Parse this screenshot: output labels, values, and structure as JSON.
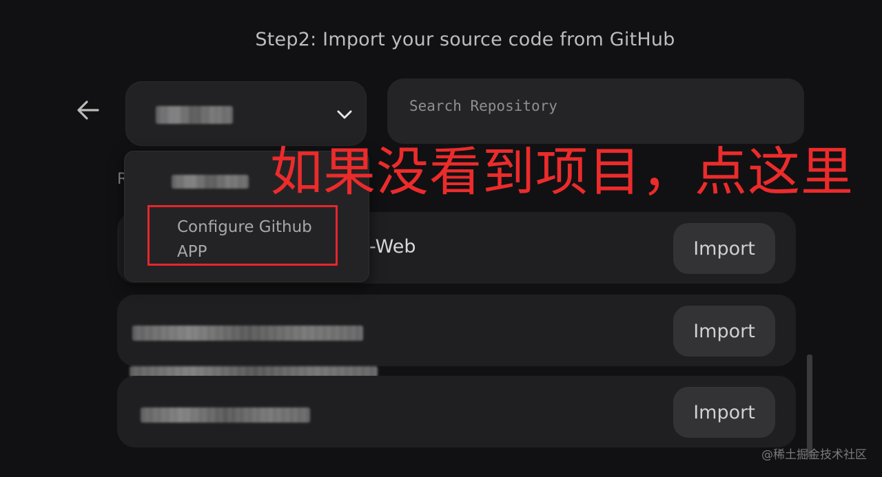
{
  "page": {
    "step_title": "Step2: Import your source code from GitHub"
  },
  "icons": {
    "back": "arrow-left-icon",
    "chevron": "chevron-down-icon"
  },
  "account_select": {
    "selected_value_obscured": true
  },
  "search": {
    "placeholder": "Search Repository",
    "value": ""
  },
  "list_header_letter": "R",
  "dropdown": {
    "configure_line1": "Configure Github",
    "configure_line2": "APP"
  },
  "repos": [
    {
      "name_visible_fragment": "-Web",
      "import_label": "Import"
    },
    {
      "name_obscured": true,
      "import_label": "Import"
    },
    {
      "name_obscured": true,
      "import_label": "Import"
    }
  ],
  "annotation": {
    "text": "如果没看到项目，点这里",
    "color": "#ec2b2b"
  },
  "watermark": "@稀土掘金技术社区",
  "colors": {
    "background": "#111113",
    "card": "#1f1f21",
    "button": "#333335",
    "highlight": "#e8262c"
  }
}
